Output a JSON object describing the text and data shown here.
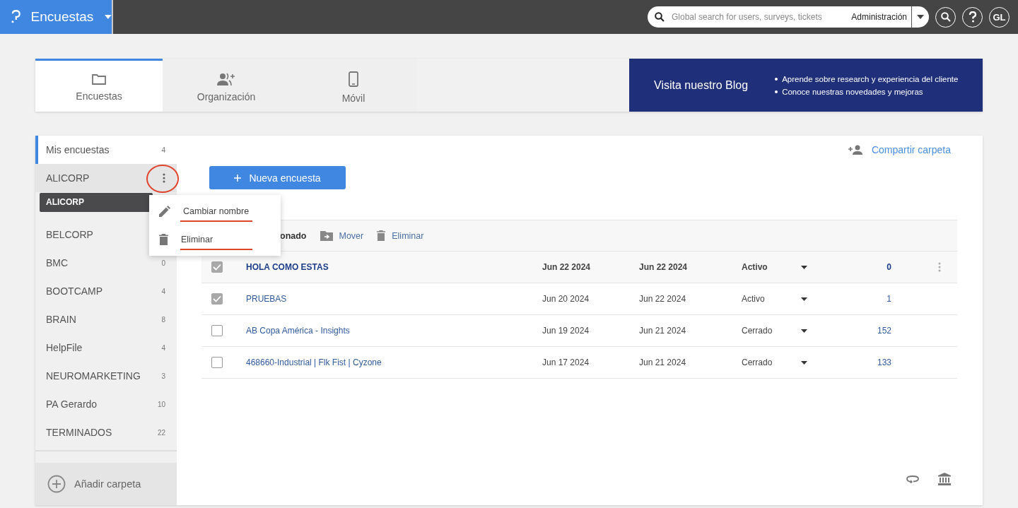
{
  "top_bar": {
    "app_name": "Encuestas",
    "search": {
      "placeholder": "Global search for users, surveys, tickets"
    },
    "scope": "Administración",
    "avatar": "GL"
  },
  "tabs": [
    {
      "label": "Encuestas",
      "selected": true
    },
    {
      "label": "Organización",
      "selected": false
    },
    {
      "label": "Móvil",
      "selected": false
    }
  ],
  "blog_banner": {
    "title": "Visita nuestro Blog",
    "bullets": [
      "Aprende sobre research y experiencia del cliente",
      "Conoce nuestras novedades y mejoras"
    ]
  },
  "sidebar": {
    "items": [
      {
        "name": "Mis encuestas",
        "count": "4",
        "selected": true,
        "hovered": false
      },
      {
        "name": "ALICORP",
        "selected": false,
        "hovered": true,
        "tooltip": "ALICORP"
      },
      {
        "name": "BELCORP",
        "selected": false,
        "hovered": false
      },
      {
        "name": "BMC",
        "count": "0",
        "selected": false,
        "hovered": false
      },
      {
        "name": "BOOTCAMP",
        "count": "4",
        "selected": false,
        "hovered": false
      },
      {
        "name": "BRAIN",
        "count": "8",
        "selected": false,
        "hovered": false
      },
      {
        "name": "HelpFile",
        "count": "4",
        "selected": false,
        "hovered": false
      },
      {
        "name": "NEUROMARKETING",
        "count": "3",
        "selected": false,
        "hovered": false
      },
      {
        "name": "PA Gerardo",
        "count": "10",
        "selected": false,
        "hovered": false
      },
      {
        "name": "TERMINADOS",
        "count": "22",
        "selected": false,
        "hovered": false
      }
    ],
    "add_folder": "Añadir carpeta"
  },
  "context_menu": {
    "items": [
      "Cambiar nombre",
      "Eliminar"
    ]
  },
  "share_folder": "Compartir carpeta",
  "new_survey_button": "Nueva encuesta",
  "bulk_bar": {
    "selection_label": "onado",
    "actions": [
      "Mover",
      "Eliminar"
    ]
  },
  "table": {
    "rows": [
      {
        "name": "HOLA COMO ESTAS",
        "created": "Jun 22 2024",
        "modified": "Jun 22 2024",
        "status": "Activo",
        "responses": "0",
        "checked": true,
        "highlighted": true
      },
      {
        "name": "PRUEBAS",
        "created": "Jun 20 2024",
        "modified": "Jun 22 2024",
        "status": "Activo",
        "responses": "1",
        "checked": true,
        "highlighted": false
      },
      {
        "name": "AB Copa América - Insights",
        "created": "Jun 19 2024",
        "modified": "Jun 21 2024",
        "status": "Cerrado",
        "responses": "152",
        "checked": false,
        "highlighted": false
      },
      {
        "name": "468660-Industrial | Flk Fist | Cyzone",
        "created": "Jun 17 2024",
        "modified": "Jun 21 2024",
        "status": "Cerrado",
        "responses": "133",
        "checked": false,
        "highlighted": false
      }
    ]
  }
}
